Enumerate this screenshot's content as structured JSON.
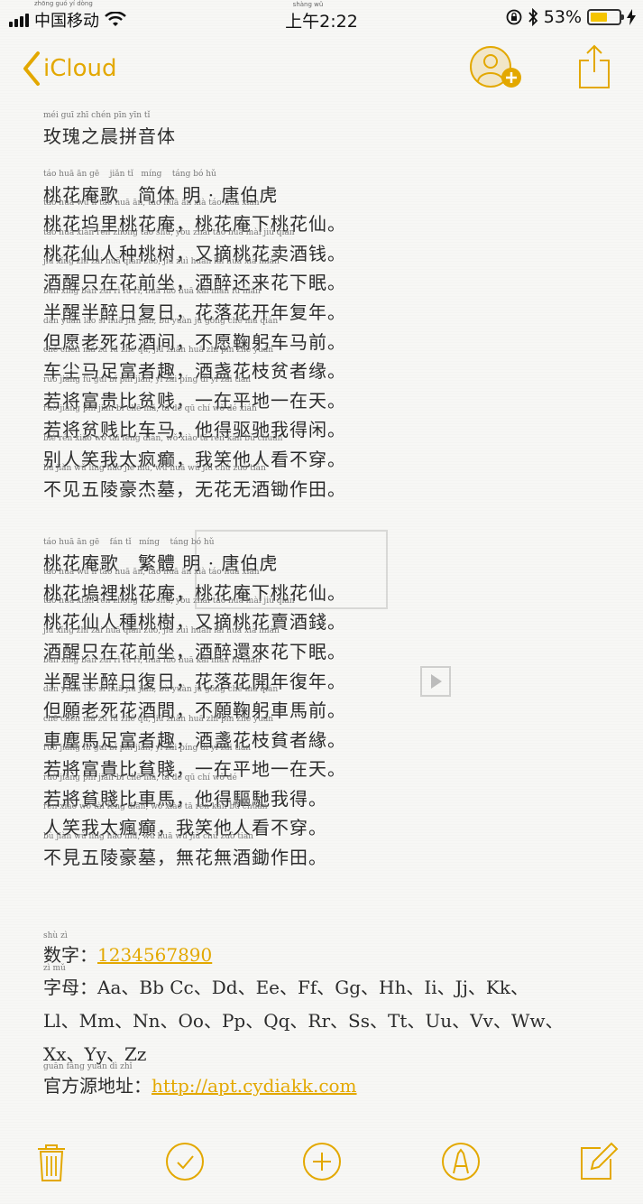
{
  "status": {
    "carrier": "中国移动",
    "carrier_pinyin": "zhōng guó yí dòng",
    "time": "上午2:22",
    "time_pinyin": "shàng wǔ",
    "battery": "53%",
    "battery_level": 53
  },
  "nav": {
    "back_label": "iCloud"
  },
  "colors": {
    "accent": "#e3a800"
  },
  "note": {
    "sections": [
      {
        "lines": [
          {
            "py": "méi guī zhī chén pīn yīn tǐ",
            "tx": "玫瑰之晨拼音体"
          }
        ]
      },
      {
        "lines": [
          {
            "py": "táo huā ān gē &nbsp;&nbsp; jiǎn tǐ &nbsp; míng &nbsp;&nbsp; táng bó hǔ",
            "tx": "桃花庵歌　简体 明 · 唐伯虎"
          },
          {
            "py": "táo huā wù lǐ táo huā ān, táo huā ān xià táo huā xiān",
            "tx": "桃花坞里桃花庵，桃花庵下桃花仙。"
          },
          {
            "py": "táo huā xiān rén zhòng táo shù, yòu zhāi táo huā mài jiǔ qián",
            "tx": "桃花仙人种桃树，又摘桃花卖酒钱。"
          },
          {
            "py": "jiǔ xǐng zhǐ zài huā qián zuò, jiǔ zuì huán lái huā xià mián",
            "tx": "酒醒只在花前坐，酒醉还来花下眠。"
          },
          {
            "py": "bàn xǐng bàn zuì rì fù rì, huā luò huā kāi nián fù nián",
            "tx": "半醒半醉日复日，花落花开年复年。"
          },
          {
            "py": "dàn yuàn lǎo sǐ huā jiǔ jiān, bù yuàn jū gōng chē mǎ qián",
            "tx": "但愿老死花酒间，不愿鞠躬车马前。"
          },
          {
            "py": "chē chén mǎ zú fù zhě qù, jiǔ zhǎn huā zhī pín zhě yuán",
            "tx": "车尘马足富者趣，酒盏花枝贫者缘。"
          },
          {
            "py": "ruò jiāng fù guì bǐ pín jiàn, yī zài píng dì yī zài tiān",
            "tx": "若将富贵比贫贱，一在平地一在天。"
          },
          {
            "py": "ruò jiāng pín jiàn bǐ chē mǎ, tā dé qū chí wǒ dé xián",
            "tx": "若将贫贱比车马，他得驱驰我得闲。"
          },
          {
            "py": "bié rén xiào wǒ tài fēng diān, wǒ xiào tā rén kàn bù chuān",
            "tx": "别人笑我太疯癫，我笑他人看不穿。"
          },
          {
            "py": "bù jiàn wǔ líng háo jié mù, wú huā wú jiǔ chú zuò tián",
            "tx": "不见五陵豪杰墓，无花无酒锄作田。"
          }
        ]
      },
      {
        "lines": [
          {
            "py": "táo huā ān gē &nbsp;&nbsp; fán tǐ &nbsp; míng &nbsp;&nbsp; táng bó hǔ",
            "tx": "桃花庵歌　繁體 明 · 唐伯虎"
          },
          {
            "py": "táo huā wù lǐ táo huā ān, táo huā ān xià táo huā xiān",
            "tx": "桃花塢裡桃花庵，桃花庵下桃花仙。"
          },
          {
            "py": "táo huā xiān rén zhòng táo shù, yòu zhāi táo huā mài jiǔ qián",
            "tx": "桃花仙人種桃樹，又摘桃花賣酒錢。"
          },
          {
            "py": "jiǔ xǐng zhǐ zài huā qián zuò, jiǔ zuì huán lái huā xià mián",
            "tx": "酒醒只在花前坐，酒醉還來花下眠。"
          },
          {
            "py": "bàn xǐng bàn zuì rì fù rì, huā luò huā kāi nián fù nián",
            "tx": "半醒半醉日復日，花落花開年復年。"
          },
          {
            "py": "dàn yuàn lǎo sǐ huā jiǔ jiān, bù yuàn jū gōng chē mǎ qián",
            "tx": "但願老死花酒間，不願鞠躬車馬前。"
          },
          {
            "py": "chē chén mǎ zú fù zhě qù, jiǔ zhǎn huā zhī pín zhě yuán",
            "tx": "車塵馬足富者趣，酒盞花枝貧者緣。"
          },
          {
            "py": "ruò jiāng fù guì bǐ pín jiàn, yī zài píng dì yī zài tiān",
            "tx": "若將富貴比貧賤，一在平地一在天。"
          },
          {
            "py": "ruò jiāng pín jiàn bǐ chē mǎ, tā dé qū chí wǒ dé",
            "tx": "若將貧賤比車馬，他得驅馳我得。"
          },
          {
            "py": "rén xiào wǒ tài fēng diān, wǒ xiào tā rén kàn bù chuān",
            "tx": "人笑我太瘋癲，我笑他人看不穿。"
          },
          {
            "py": "bù jiàn wǔ líng háo mù, wú huā wú jiǔ chú zuò tián",
            "tx": "不見五陵豪墓，無花無酒鋤作田。"
          }
        ]
      }
    ]
  },
  "meta": {
    "numbers_label": "数字：",
    "numbers_label_py": "shù zì",
    "numbers_value": "1234567890",
    "letters_label": "字母：",
    "letters_label_py": "zì mǔ",
    "letters_line1": "Aa、Bb Cc、Dd、Ee、Ff、Gg、Hh、Ii、Jj、Kk、",
    "letters_line2": "Ll、Mm、Nn、Oo、Pp、Qq、Rr、Ss、Tt、Uu、Vv、Ww、",
    "letters_line3": "Xx、Yy、Zz",
    "source_label": "官方源地址：",
    "source_label_py": "guān fāng yuán dì zhǐ",
    "source_url": "http://apt.cydiakk.com"
  },
  "toolbar": {
    "icons": [
      "trash-icon",
      "checkmark-icon",
      "add-icon",
      "markup-icon",
      "compose-icon"
    ]
  }
}
